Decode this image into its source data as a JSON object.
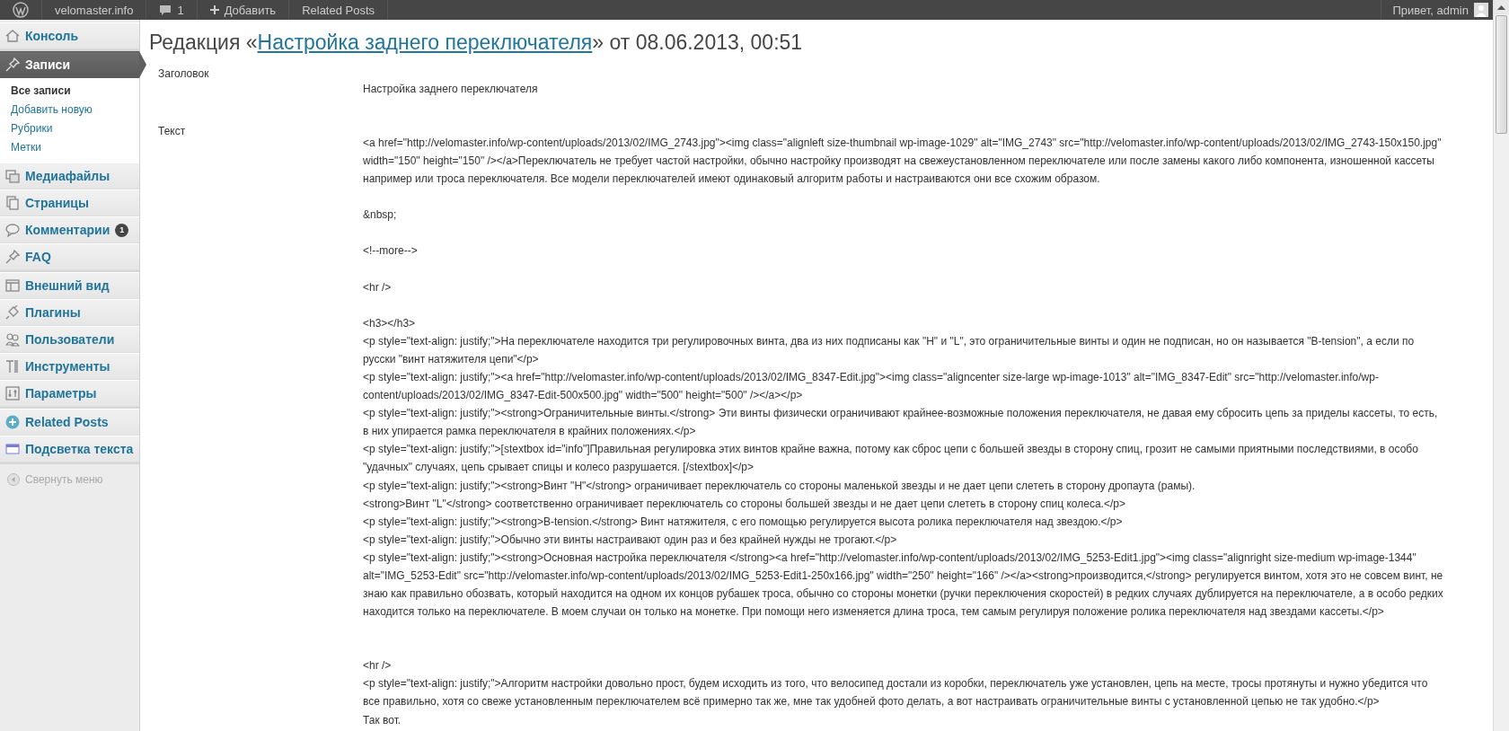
{
  "admin_bar": {
    "site": "velomaster.info",
    "comments": "1",
    "new_label": "Добавить",
    "plugin_link": "Related Posts",
    "greeting": "Привет, admin"
  },
  "sidebar": {
    "groups": [
      [
        {
          "label": "Консоль",
          "selected": false
        }
      ],
      [
        {
          "label": "Записи",
          "selected": true,
          "children": [
            {
              "label": "Все записи",
              "selected": true
            },
            {
              "label": "Добавить новую",
              "selected": false
            },
            {
              "label": "Рубрики",
              "selected": false
            },
            {
              "label": "Метки",
              "selected": false
            }
          ]
        },
        {
          "label": "Медиафайлы",
          "selected": false
        },
        {
          "label": "Страницы",
          "selected": false
        },
        {
          "label": "Комментарии",
          "selected": false,
          "badge": "1"
        },
        {
          "label": "FAQ",
          "selected": false
        }
      ],
      [
        {
          "label": "Внешний вид",
          "selected": false
        },
        {
          "label": "Плагины",
          "selected": false
        },
        {
          "label": "Пользователи",
          "selected": false
        },
        {
          "label": "Инструменты",
          "selected": false
        },
        {
          "label": "Параметры",
          "selected": false
        }
      ],
      [
        {
          "label": "Related Posts",
          "selected": false
        },
        {
          "label": "Подсветка текста",
          "selected": false
        }
      ]
    ],
    "collapse_label": "Свернуть меню"
  },
  "title": {
    "prefix": "Редакция «",
    "link": "Настройка заднего переключателя",
    "suffix": "» от 08.06.2013, 00:51"
  },
  "revision": {
    "title_label": "Заголовок",
    "title_value": "Настройка заднего переключателя",
    "text_label": "Текст",
    "paragraphs": [
      {
        "kind": "line",
        "text": "<a href=\"http://velomaster.info/wp-content/uploads/2013/02/IMG_2743.jpg\"><img class=\"alignleft size-thumbnail wp-image-1029\" alt=\"IMG_2743\" src=\"http://velomaster.info/wp-content/uploads/2013/02/IMG_2743-150x150.jpg\" width=\"150\" height=\"150\" /></a>Переключатель не требует частой настройки, обычно настройку производят на свежеустановленном переключателе или после замены какого либо компонента, изношенной кассеты например или троса переключателя. Все модели переключателей имеют одинаковый алгоритм работы и настраиваются они все схожим образом."
      },
      {
        "kind": "after_blank",
        "text": "&nbsp;"
      },
      {
        "kind": "after_blank",
        "text": "<!--more-->"
      },
      {
        "kind": "after_blank",
        "text": "<hr />"
      },
      {
        "kind": "after_blank",
        "text": "<h3></h3>"
      },
      {
        "kind": "line",
        "text": "<p style=\"text-align: justify;\">На переключателе находится три регулировочных винта, два из них подписаны как \"H\" и \"L\", это ограничительные винты и один не подписан, но он называется \"B-tension\", а если по русски \"винт натяжителя цепи\"</p>"
      },
      {
        "kind": "line",
        "text": "<p style=\"text-align: justify;\"><a href=\"http://velomaster.info/wp-content/uploads/2013/02/IMG_8347-Edit.jpg\"><img class=\"aligncenter size-large wp-image-1013\" alt=\"IMG_8347-Edit\" src=\"http://velomaster.info/wp-content/uploads/2013/02/IMG_8347-Edit-500x500.jpg\" width=\"500\" height=\"500\" /></a></p>"
      },
      {
        "kind": "line",
        "text": "<p style=\"text-align: justify;\"><strong>Ограничительные винты.</strong> Эти винты физически ограничивают крайнее-возможные положения переключателя, не давая ему сбросить цепь за приделы кассеты, то есть, в них упирается рамка переключателя в крайних положениях.</p>"
      },
      {
        "kind": "line",
        "text": "<p style=\"text-align: justify;\">[stextbox id=\"info\"]Правильная регулировка этих винтов крайне важна, потому как сброс цепи с большей звезды в сторону спиц, грозит не самыми приятными последствиями, в особо \"удачных\" случаях, цепь срывает спицы и колесо разрушается. [/stextbox]</p>"
      },
      {
        "kind": "line",
        "text": "<p style=\"text-align: justify;\"><strong>Винт \"H\"</strong> ограничивает переключатель со стороны маленькой звезды и не дает цепи слететь в сторону дропаута (рамы)."
      },
      {
        "kind": "line",
        "text": "<strong>Винт \"L\"</strong> соответственно ограничивает переключатель со стороны большей звезды и не дает цепи слететь в сторону спиц колеса.</p>"
      },
      {
        "kind": "line",
        "text": "<p style=\"text-align: justify;\"><strong>B-tension.</strong> Винт натяжителя, с его помощью регулируется высота ролика переключателя над звездою.</p>"
      },
      {
        "kind": "line",
        "text": "<p style=\"text-align: justify;\">Обычно эти винты настраивают один раз и без крайней нужды не трогают.</p>"
      },
      {
        "kind": "line",
        "text": "<p style=\"text-align: justify;\"><strong>Основная настройка переключателя </strong><a href=\"http://velomaster.info/wp-content/uploads/2013/02/IMG_5253-Edit1.jpg\"><img class=\"alignright size-medium wp-image-1344\" alt=\"IMG_5253-Edit\" src=\"http://velomaster.info/wp-content/uploads/2013/02/IMG_5253-Edit1-250x166.jpg\" width=\"250\" height=\"166\" /></a><strong>производится,</strong> регулируется винтом, хотя это не совсем винт, не знаю как правильно обозвать, который находится на одном их концов рубашек троса, обычно со стороны монетки (ручки переключения скоростей) в редких случаях дублируется на переключателе, а в особо редких находится только на переключателе. В моем случаи он только на монетке. При помощи него изменяется длина троса, тем самым регулируя положение ролика переключателя над звездами кассеты.</p>"
      },
      {
        "kind": "after_two_blanks",
        "text": "<hr />"
      },
      {
        "kind": "line",
        "text": "<p style=\"text-align: justify;\">Алгоритм настройки довольно прост, будем исходить из того, что велосипед достали из коробки, переключатель уже установлен, цепь на месте, тросы протянуты и нужно убедится что все правильно, хотя со свеже установленным переключателем всё примерно так же, мне так удобней фото делать, а вот настраивать ограничительные винты с установленной цепью не так удобно.</p>"
      },
      {
        "kind": "line",
        "text": "Так вот."
      }
    ]
  }
}
